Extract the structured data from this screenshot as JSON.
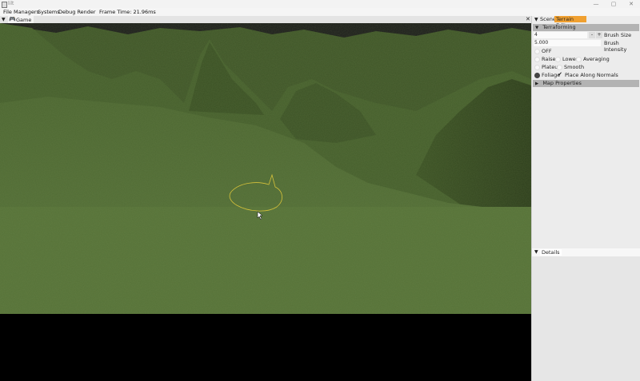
{
  "window": {
    "title": "lilt",
    "min": "—",
    "max": "▢",
    "close": "✕"
  },
  "menu": {
    "items": [
      "File",
      "Managers",
      "Systems",
      "Debug Render"
    ],
    "frame_time": "Frame Time: 21.96ms"
  },
  "game_tab": {
    "label": "Game"
  },
  "viewport": {
    "sky": "#1b1b1b",
    "grass": "#4f6a33",
    "grass_light": "#5d7a3c",
    "grass_dark": "#36491f",
    "brush_color": "#d6c23a"
  },
  "right_panel": {
    "close": "✕",
    "tabs": [
      {
        "label": "Scene"
      },
      {
        "label": "Terrain Editor"
      }
    ],
    "active_tab_color": "#f0a030",
    "terraforming": {
      "header": "Terraforming",
      "brush_size_value": "4",
      "brush_size_label": "Brush Size",
      "brush_intensity_value": "5.000",
      "brush_intensity_label": "Brush Intensity",
      "off_label": "OFF",
      "modes": [
        "Raise",
        "Lower",
        "Averaging",
        "Plateu",
        "Smooth"
      ],
      "foliage_label": "Foliage",
      "normals_label": "Place Along Normals",
      "minus": "-",
      "plus": "+"
    },
    "map_properties": {
      "header": "Map Properties"
    },
    "details": {
      "label": "Details"
    }
  }
}
